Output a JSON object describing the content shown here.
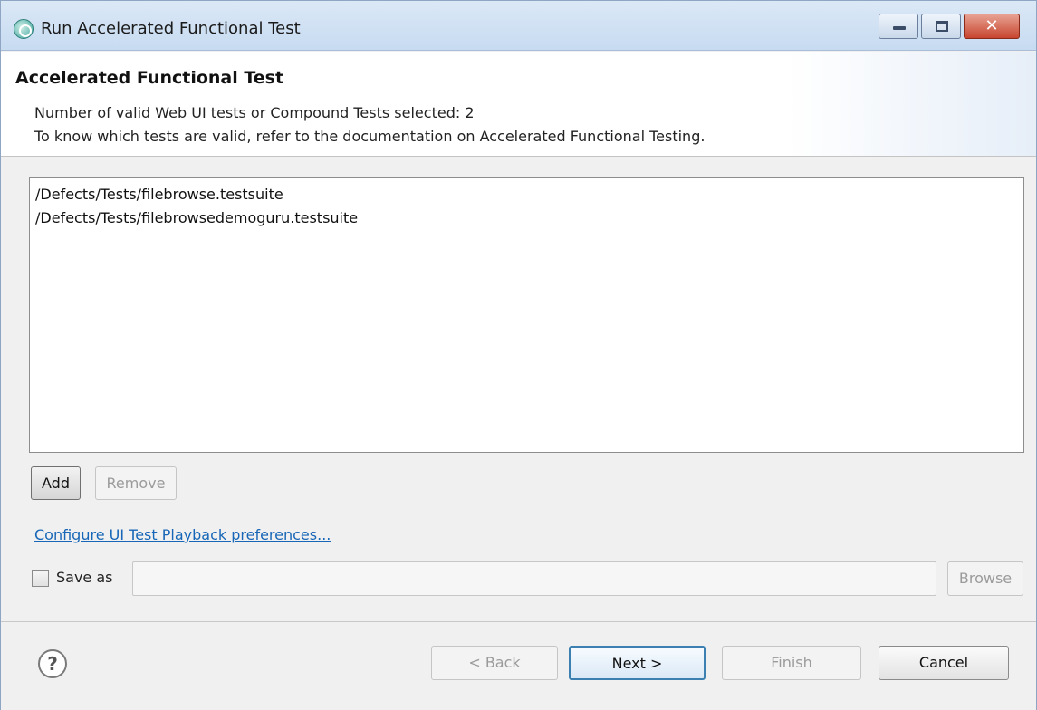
{
  "window": {
    "title": "Run Accelerated Functional Test",
    "controls": {
      "minimize_icon": "minimize-icon",
      "maximize_icon": "maximize-icon",
      "close_glyph": "✕"
    }
  },
  "header": {
    "title": "Accelerated Functional Test",
    "description_line1": "Number of valid Web UI tests or Compound Tests selected: 2",
    "description_line2": "To know which tests are valid, refer to the documentation on Accelerated Functional Testing."
  },
  "tests": {
    "items": [
      "/Defects/Tests/filebrowse.testsuite",
      "/Defects/Tests/filebrowsedemoguru.testsuite"
    ],
    "add_label": "Add",
    "remove_label": "Remove"
  },
  "preferences_link": "Configure UI Test Playback preferences...",
  "save_as": {
    "label": "Save as",
    "checked": false,
    "value": "",
    "browse_label": "Browse"
  },
  "footer": {
    "help_glyph": "?",
    "back_label": "< Back",
    "next_label": "Next >",
    "finish_label": "Finish",
    "cancel_label": "Cancel"
  },
  "colors": {
    "link": "#1766b7",
    "titlebar": "#c7dbf1",
    "close_button": "#c7452e",
    "default_button_border": "#3c7fb1"
  }
}
